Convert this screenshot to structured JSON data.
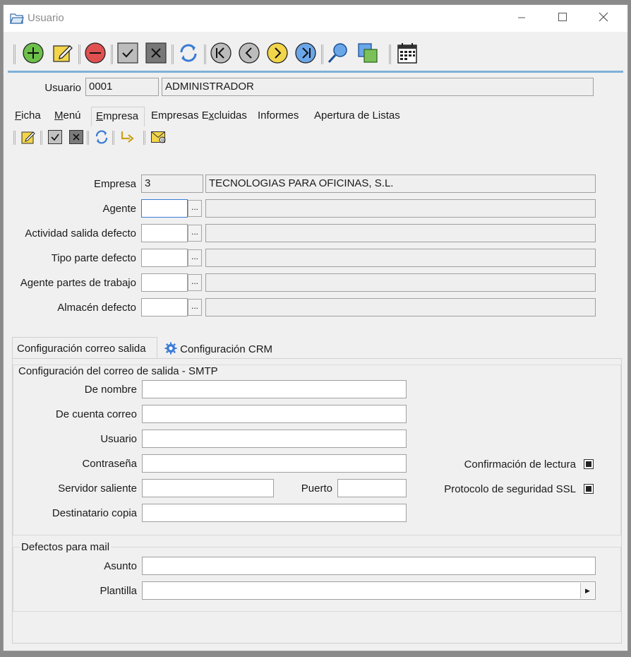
{
  "window": {
    "title": "Usuario"
  },
  "header": {
    "usuario_label": "Usuario",
    "usuario_code": "0001",
    "usuario_name": "ADMINISTRADOR"
  },
  "tabs": [
    {
      "label": "Ficha"
    },
    {
      "label": "Menú"
    },
    {
      "label": "Empresa"
    },
    {
      "label": "Empresas Excluidas"
    },
    {
      "label": "Informes"
    },
    {
      "label": "Apertura de Listas"
    }
  ],
  "empresa_form": {
    "empresa": {
      "label": "Empresa",
      "code": "3",
      "name": "TECNOLOGIAS PARA OFICINAS, S.L."
    },
    "agente": {
      "label": "Agente",
      "code": "",
      "name": ""
    },
    "actividad": {
      "label": "Actividad salida defecto",
      "code": "",
      "name": ""
    },
    "tipo_parte": {
      "label": "Tipo parte defecto",
      "code": "",
      "name": ""
    },
    "agente_partes": {
      "label": "Agente partes de trabajo",
      "code": "",
      "name": ""
    },
    "almacen": {
      "label": "Almacén defecto",
      "code": "",
      "name": ""
    },
    "lookup_label": "..."
  },
  "panel_tabs": [
    {
      "label": "Configuración correo salida"
    },
    {
      "label": "Configuración CRM"
    }
  ],
  "smtp": {
    "group_title": "Configuración del correo de salida - SMTP",
    "de_nombre": {
      "label": "De nombre",
      "value": ""
    },
    "de_cuenta": {
      "label": "De cuenta correo",
      "value": ""
    },
    "usuario": {
      "label": "Usuario",
      "value": ""
    },
    "contrasena": {
      "label": "Contraseña",
      "value": ""
    },
    "servidor": {
      "label": "Servidor saliente",
      "value": ""
    },
    "puerto": {
      "label": "Puerto",
      "value": ""
    },
    "destinatario": {
      "label": "Destinatario copia",
      "value": ""
    },
    "confirmacion": {
      "label": "Confirmación de lectura",
      "checked": true
    },
    "ssl": {
      "label": "Protocolo de seguridad SSL",
      "checked": true
    }
  },
  "defectos": {
    "group_title": "Defectos para mail",
    "asunto": {
      "label": "Asunto",
      "value": ""
    },
    "plantilla": {
      "label": "Plantilla",
      "value": ""
    }
  },
  "icons": {
    "toolbar": [
      "add-icon",
      "edit-icon",
      "delete-icon",
      "accept-icon",
      "cancel-icon",
      "refresh-icon",
      "first-record-icon",
      "previous-record-icon",
      "next-record-icon",
      "last-record-icon",
      "search-icon",
      "copy-icon",
      "calendar-icon"
    ],
    "subtoolbar": [
      "edit-icon",
      "accept-icon",
      "cancel-icon",
      "refresh-icon",
      "forward-arrow-icon",
      "mail-icon"
    ]
  },
  "colors": {
    "accent_line": "#7fb0d8",
    "add_green": "#6cc04a",
    "delete_red": "#e05050",
    "nav_yellow": "#f2d54a",
    "nav_blue": "#6aa6e8"
  }
}
